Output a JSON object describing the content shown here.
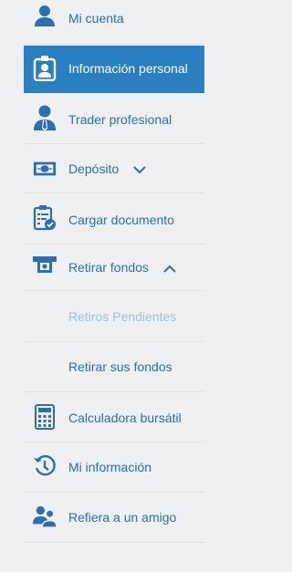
{
  "colors": {
    "accent": "#2a7fc1",
    "text": "#2a6fb0",
    "muted": "#9fc0dc",
    "background": "#eef0f1"
  },
  "menu": {
    "my_account": {
      "label": "Mi cuenta",
      "icon": "user-icon"
    },
    "personal_info": {
      "label": "Información personal",
      "icon": "id-badge-icon",
      "active": true
    },
    "pro_trader": {
      "label": "Trader profesional",
      "icon": "businessman-icon"
    },
    "deposit": {
      "label": "Depósito",
      "icon": "banknote-icon",
      "chevron": "chevron-down-icon"
    },
    "upload_doc": {
      "label": "Cargar documento",
      "icon": "clipboard-check-icon"
    },
    "withdraw": {
      "label": "Retirar fondos",
      "icon": "atm-withdraw-icon",
      "chevron": "chevron-up-icon",
      "expanded": true,
      "children": [
        {
          "label": "Retiros Pendientes"
        },
        {
          "label": "Retirar sus fondos"
        }
      ]
    },
    "calculator": {
      "label": "Calculadora bursátil",
      "icon": "calculator-icon"
    },
    "my_info": {
      "label": "Mi información",
      "icon": "history-icon"
    },
    "refer": {
      "label": "Refiera a un amigo",
      "icon": "refer-friend-icon"
    }
  }
}
